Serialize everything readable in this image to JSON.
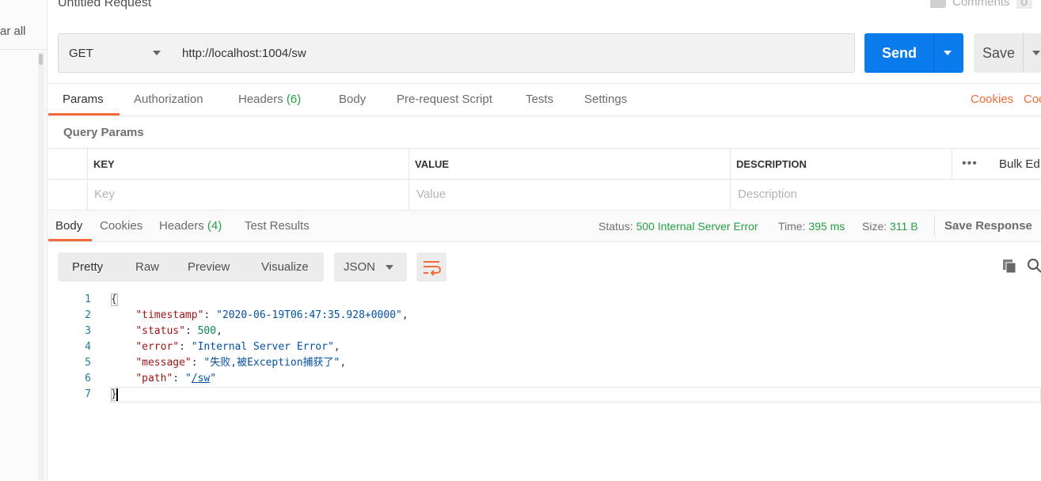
{
  "sidebar": {
    "clear_all": "ar all"
  },
  "request": {
    "title": "Untitled Request",
    "comments_label": "Comments",
    "comments_count": "0",
    "method": "GET",
    "url": "http://localhost:1004/sw",
    "send_label": "Send",
    "save_label": "Save"
  },
  "req_tabs": {
    "params": "Params",
    "authorization": "Authorization",
    "headers": "Headers",
    "headers_count": "(6)",
    "body": "Body",
    "prerequest": "Pre-request Script",
    "tests": "Tests",
    "settings": "Settings",
    "cookies": "Cookies",
    "code": "Coc"
  },
  "query_params": {
    "title": "Query Params",
    "col_key": "KEY",
    "col_value": "VALUE",
    "col_description": "DESCRIPTION",
    "bulk_edit": "Bulk Ed",
    "key_placeholder": "Key",
    "value_placeholder": "Value",
    "description_placeholder": "Description"
  },
  "response": {
    "tabs": {
      "body": "Body",
      "cookies": "Cookies",
      "headers": "Headers",
      "headers_count": "(4)",
      "test_results": "Test Results"
    },
    "status_label": "Status:",
    "status_value": "500 Internal Server Error",
    "time_label": "Time:",
    "time_value": "395 ms",
    "size_label": "Size:",
    "size_value": "311 B",
    "save_response": "Save Response",
    "formats": {
      "pretty": "Pretty",
      "raw": "Raw",
      "preview": "Preview",
      "visualize": "Visualize"
    },
    "language": "JSON",
    "line_numbers": [
      "1",
      "2",
      "3",
      "4",
      "5",
      "6",
      "7"
    ],
    "body": {
      "open": "{",
      "timestamp_key": "\"timestamp\"",
      "timestamp_val": "\"2020-06-19T06:47:35.928+0000\"",
      "status_key": "\"status\"",
      "status_val": "500",
      "error_key": "\"error\"",
      "error_val": "\"Internal Server Error\"",
      "message_key": "\"message\"",
      "message_val": "\"失败,被Exception捕获了\"",
      "path_key": "\"path\"",
      "path_q1": "\"",
      "path_val": "/sw",
      "path_q2": "\"",
      "close": "}"
    }
  },
  "icons": {
    "copy": "copy-icon",
    "search": "search-icon",
    "wrap": "wrap-lines-icon",
    "comment": "comment-icon"
  },
  "colors": {
    "send_button": "#097bed",
    "accent": "#f26b3a",
    "success": "#26a042"
  }
}
